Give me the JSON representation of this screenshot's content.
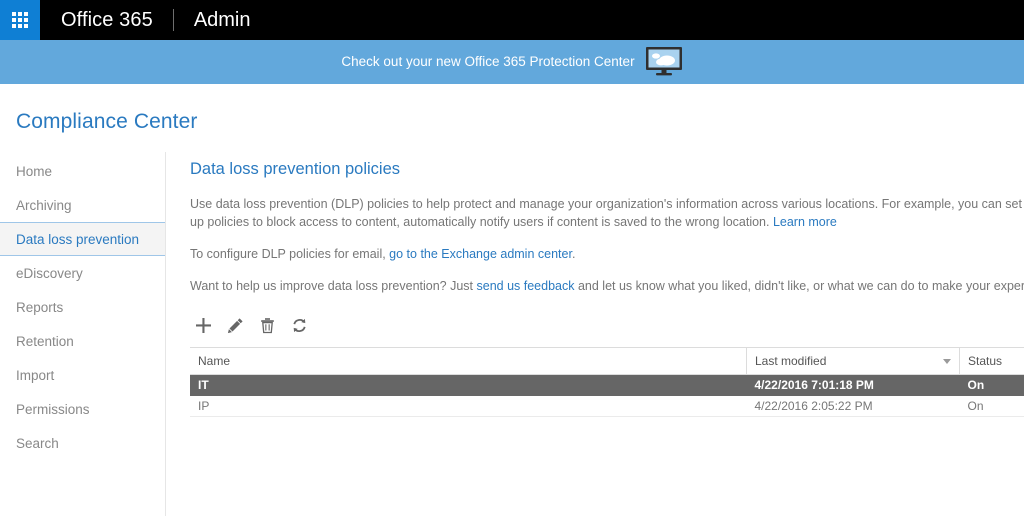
{
  "suite": {
    "waffle_icon": "app-launcher-waffle-icon",
    "brand": "Office 365",
    "app": "Admin"
  },
  "promo": {
    "text": "Check out your new Office 365 Protection Center",
    "icon": "monitor-cloud-icon",
    "background": "#62a8dc"
  },
  "page": {
    "title": "Compliance Center",
    "accent": "#2a7ac0"
  },
  "sidebar": {
    "items": [
      {
        "label": "Home",
        "selected": false
      },
      {
        "label": "Archiving",
        "selected": false
      },
      {
        "label": "Data loss prevention",
        "selected": true
      },
      {
        "label": "eDiscovery",
        "selected": false
      },
      {
        "label": "Reports",
        "selected": false
      },
      {
        "label": "Retention",
        "selected": false
      },
      {
        "label": "Import",
        "selected": false
      },
      {
        "label": "Permissions",
        "selected": false
      },
      {
        "label": "Search",
        "selected": false
      }
    ]
  },
  "main": {
    "heading": "Data loss prevention policies",
    "intro": {
      "text_before": "Use data loss prevention (DLP) policies to help protect and manage your organization's information across various locations. For example, you can set up policies to block access to content, automatically notify users if content is saved to the wrong location. ",
      "link": "Learn more"
    },
    "exchange": {
      "text_before": "To configure DLP policies for email, ",
      "link": "go to the Exchange admin center",
      "text_after": "."
    },
    "feedback": {
      "text_before": "Want to help us improve data loss prevention? Just ",
      "link": "send us feedback",
      "text_after": " and let us know what you liked, didn't like, or what we can do to make your experience better."
    },
    "toolbar": [
      {
        "name": "add-policy-button",
        "icon": "plus-icon"
      },
      {
        "name": "edit-policy-button",
        "icon": "pencil-icon"
      },
      {
        "name": "delete-policy-button",
        "icon": "trash-icon"
      },
      {
        "name": "refresh-button",
        "icon": "refresh-icon"
      }
    ],
    "table": {
      "columns": [
        "Name",
        "Last modified",
        "Status"
      ],
      "sorted_column": "Last modified",
      "rows": [
        {
          "name": "IT",
          "last_modified": "4/22/2016 7:01:18 PM",
          "status": "On",
          "selected": true
        },
        {
          "name": "IP",
          "last_modified": "4/22/2016 2:05:22 PM",
          "status": "On",
          "selected": false
        }
      ]
    }
  }
}
